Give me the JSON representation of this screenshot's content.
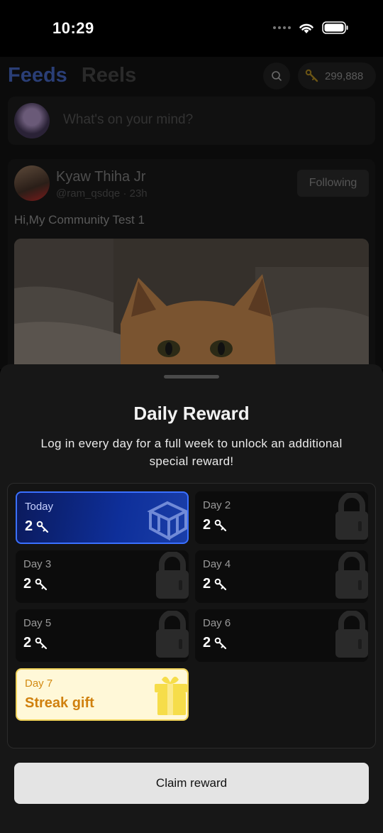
{
  "status_bar": {
    "time": "10:29"
  },
  "header": {
    "tabs": [
      {
        "label": "Feeds",
        "active": true
      },
      {
        "label": "Reels",
        "active": false
      }
    ],
    "key_balance": "299,888"
  },
  "composer": {
    "placeholder": "What's on your mind?"
  },
  "post": {
    "author": "Kyaw Thiha Jr",
    "meta": "@ram_qsdqe · 23h",
    "follow_label": "Following",
    "text": "Hi,My Community Test 1"
  },
  "reward_sheet": {
    "title": "Daily Reward",
    "subtitle": "Log in every day for a full week to unlock an additional special reward!",
    "days": [
      {
        "label": "Today",
        "value": "2",
        "state": "current"
      },
      {
        "label": "Day 2",
        "value": "2",
        "state": "locked"
      },
      {
        "label": "Day 3",
        "value": "2",
        "state": "locked"
      },
      {
        "label": "Day 4",
        "value": "2",
        "state": "locked"
      },
      {
        "label": "Day 5",
        "value": "2",
        "state": "locked"
      },
      {
        "label": "Day 6",
        "value": "2",
        "state": "locked"
      }
    ],
    "streak_day": {
      "label": "Day 7",
      "value": "Streak gift"
    },
    "claim_label": "Claim reward"
  },
  "colors": {
    "accent_blue": "#3a70ff",
    "gift_gold": "#d0800e",
    "sheet_bg": "#171717"
  }
}
